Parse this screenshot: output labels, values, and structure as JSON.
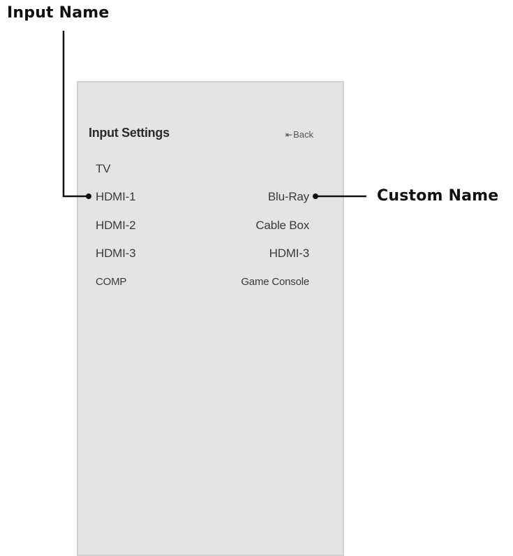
{
  "callouts": {
    "input_name": "Input Name",
    "custom_name": "Custom Name"
  },
  "panel": {
    "title": "Input Settings",
    "back_label": "Back",
    "back_icon": "back-arrow-icon",
    "rows": [
      {
        "input": "TV",
        "custom": ""
      },
      {
        "input": "HDMI-1",
        "custom": "Blu-Ray"
      },
      {
        "input": "HDMI-2",
        "custom": "Cable Box"
      },
      {
        "input": "HDMI-3",
        "custom": "HDMI-3"
      },
      {
        "input": "COMP",
        "custom": "Game Console"
      }
    ]
  },
  "colors": {
    "panel_background": "#e4e4e4",
    "panel_border": "#cfcfcf",
    "callout_line": "#111111"
  }
}
